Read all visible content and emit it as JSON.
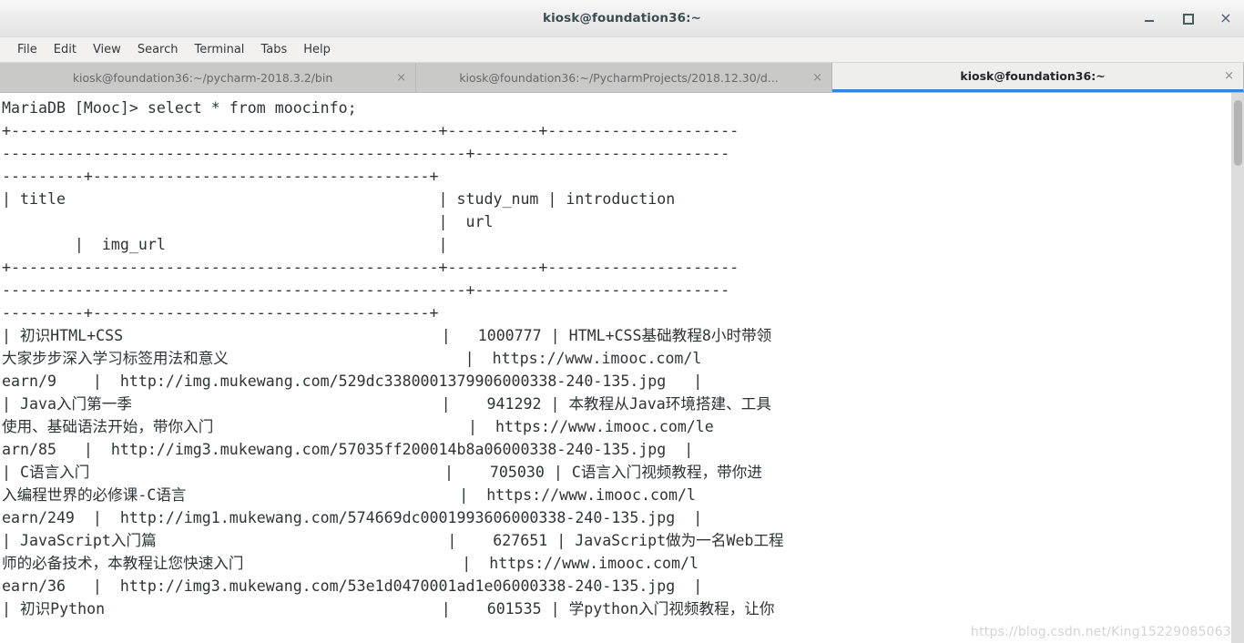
{
  "window": {
    "title": "kiosk@foundation36:~",
    "controls": {
      "minimize": "–",
      "maximize": "□",
      "close": "×"
    }
  },
  "menubar": {
    "items": [
      {
        "label": "File"
      },
      {
        "label": "Edit"
      },
      {
        "label": "View"
      },
      {
        "label": "Search"
      },
      {
        "label": "Terminal"
      },
      {
        "label": "Tabs"
      },
      {
        "label": "Help"
      }
    ]
  },
  "tabs": [
    {
      "label": "kiosk@foundation36:~/pycharm-2018.3.2/bin",
      "close": "×",
      "active": false
    },
    {
      "label": "kiosk@foundation36:~/PycharmProjects/2018.12.30/d...",
      "close": "×",
      "active": false
    },
    {
      "label": "kiosk@foundation36:~",
      "close": "×",
      "active": true
    }
  ],
  "terminal": {
    "prompt": "MariaDB [Mooc]>",
    "command": "select * from moocinfo;",
    "columns": [
      "title",
      "study_num",
      "introduction",
      "url",
      "img_url"
    ],
    "rows": [
      {
        "title": "初识HTML+CSS",
        "study_num": "1000777",
        "introduction": "HTML+CSS基础教程8小时带领大家步步深入学习标签用法和意义",
        "url": "https://www.imooc.com/learn/9",
        "img_url": "http://img.mukewang.com/529dc3380001379906000338-240-135.jpg"
      },
      {
        "title": "Java入门第一季",
        "study_num": "941292",
        "introduction": "本教程从Java环境搭建、工具使用、基础语法开始，带你入门",
        "url": "https://www.imooc.com/learn/85",
        "img_url": "http://img3.mukewang.com/57035ff200014b8a06000338-240-135.jpg"
      },
      {
        "title": "C语言入门",
        "study_num": "705030",
        "introduction": "C语言入门视频教程，带你进入编程世界的必修课-C语言",
        "url": "https://www.imooc.com/learn/249",
        "img_url": "http://img1.mukewang.com/574669dc0001993606000338-240-135.jpg"
      },
      {
        "title": "JavaScript入门篇",
        "study_num": "627651",
        "introduction": "JavaScript做为一名Web工程师的必备技术，本教程让您快速入门",
        "url": "https://www.imooc.com/learn/36",
        "img_url": "http://img3.mukewang.com/53e1d0470001ad1e06000338-240-135.jpg"
      },
      {
        "title": "初识Python",
        "study_num": "601535",
        "introduction": "学python入门视频教程，让你",
        "url": "",
        "img_url": ""
      }
    ],
    "lines": [
      "MariaDB [Mooc]> select * from moocinfo;",
      "+-----------------------------------------------+----------+---------------------",
      "---------------------------------------------------+----------------------------",
      "---------+-------------------------------------+",
      "| title                                         | study_num | introduction",
      "                                                |  url",
      "        |  img_url                              |",
      "+-----------------------------------------------+----------+---------------------",
      "---------------------------------------------------+----------------------------",
      "---------+-------------------------------------+",
      "| 初识HTML+CSS                                   |   1000777 | HTML+CSS基础教程8小时带领",
      "大家步步深入学习标签用法和意义                          |  https://www.imooc.com/l",
      "earn/9    |  http://img.mukewang.com/529dc3380001379906000338-240-135.jpg   |",
      "| Java入门第一季                                  |    941292 | 本教程从Java环境搭建、工具",
      "使用、基础语法开始，带你入门                            |  https://www.imooc.com/le",
      "arn/85   |  http://img3.mukewang.com/57035ff200014b8a06000338-240-135.jpg  |",
      "| C语言入门                                       |    705030 | C语言入门视频教程，带你进",
      "入编程世界的必修课-C语言                              |  https://www.imooc.com/l",
      "earn/249  |  http://img1.mukewang.com/574669dc0001993606000338-240-135.jpg  |",
      "| JavaScript入门篇                                |    627651 | JavaScript做为一名Web工程",
      "师的必备技术，本教程让您快速入门                        |  https://www.imooc.com/l",
      "earn/36   |  http://img3.mukewang.com/53e1d0470001ad1e06000338-240-135.jpg  |",
      "| 初识Python                                     |    601535 | 学python入门视频教程，让你"
    ]
  },
  "watermark": {
    "text": "https://blog.csdn.net/King15229085063"
  },
  "colors": {
    "accent": "#3584e4",
    "terminal_fg": "#2e3436",
    "terminal_bg": "#ffffff",
    "tabbar_bg": "#c9c9c7",
    "titlebar_bg": "#ebebeb"
  }
}
